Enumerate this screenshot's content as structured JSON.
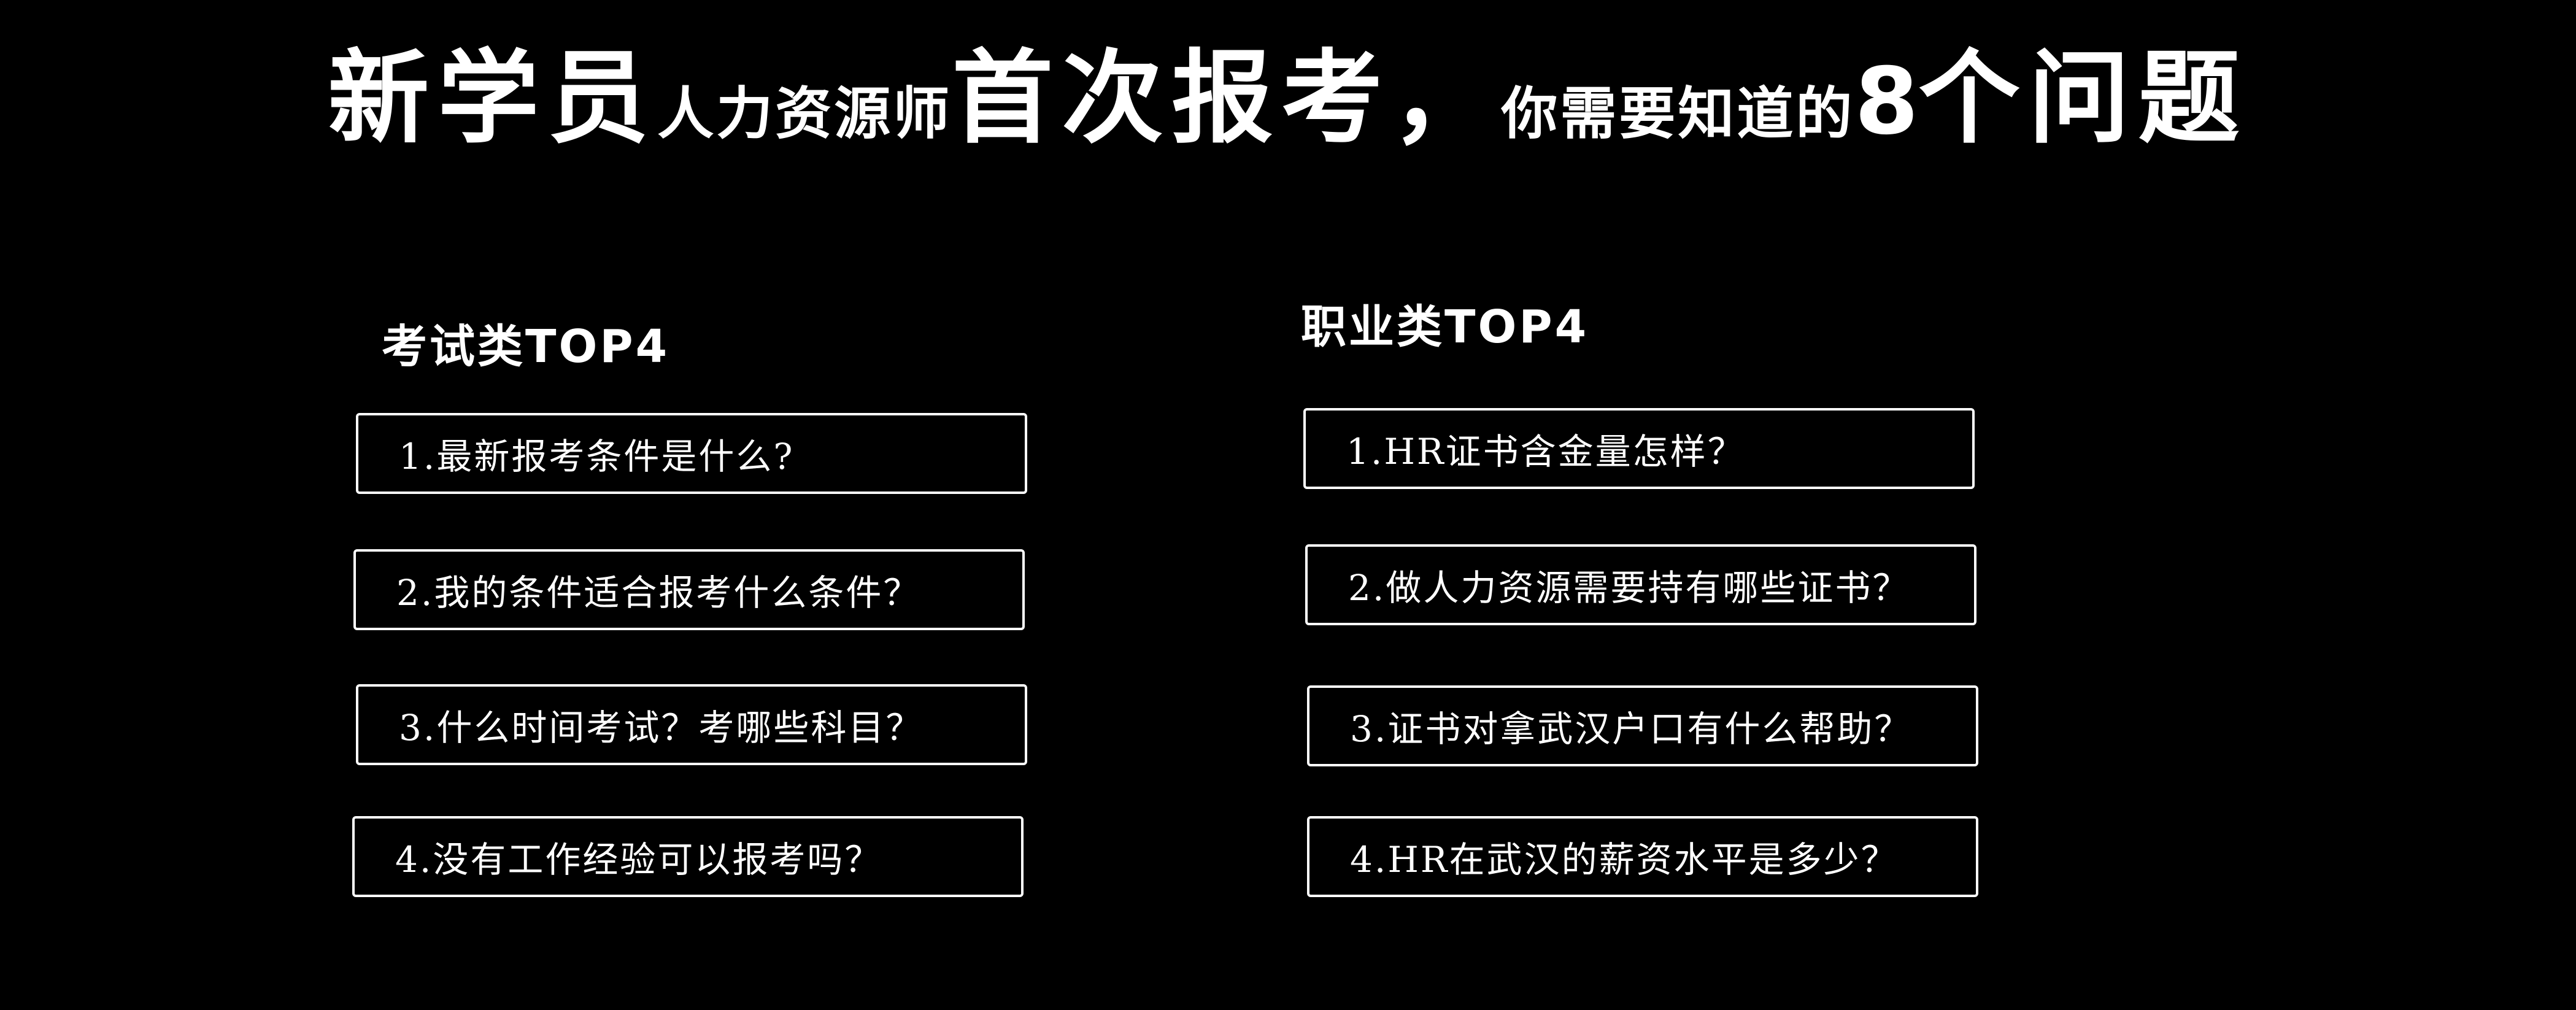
{
  "title": {
    "part1": "新学员",
    "part2": "人力资源师",
    "part3": "首次报考，",
    "part4": "你需要知道的",
    "part5": "8",
    "part6": "个问题"
  },
  "columns": [
    {
      "heading": "考试类TOP4",
      "questions": [
        "1.最新报考条件是什么?",
        "2.我的条件适合报考什么条件？",
        "3.什么时间考试？考哪些科目？",
        "4.没有工作经验可以报考吗？"
      ]
    },
    {
      "heading": "职业类TOP4",
      "questions": [
        "1.HR证书含金量怎样？",
        "2.做人力资源需要持有哪些证书？",
        "3.证书对拿武汉户口有什么帮助？",
        "4.HR在武汉的薪资水平是多少？"
      ]
    }
  ],
  "colors": {
    "background": "#000000",
    "text": "#ffffff",
    "border": "#ffffff"
  }
}
